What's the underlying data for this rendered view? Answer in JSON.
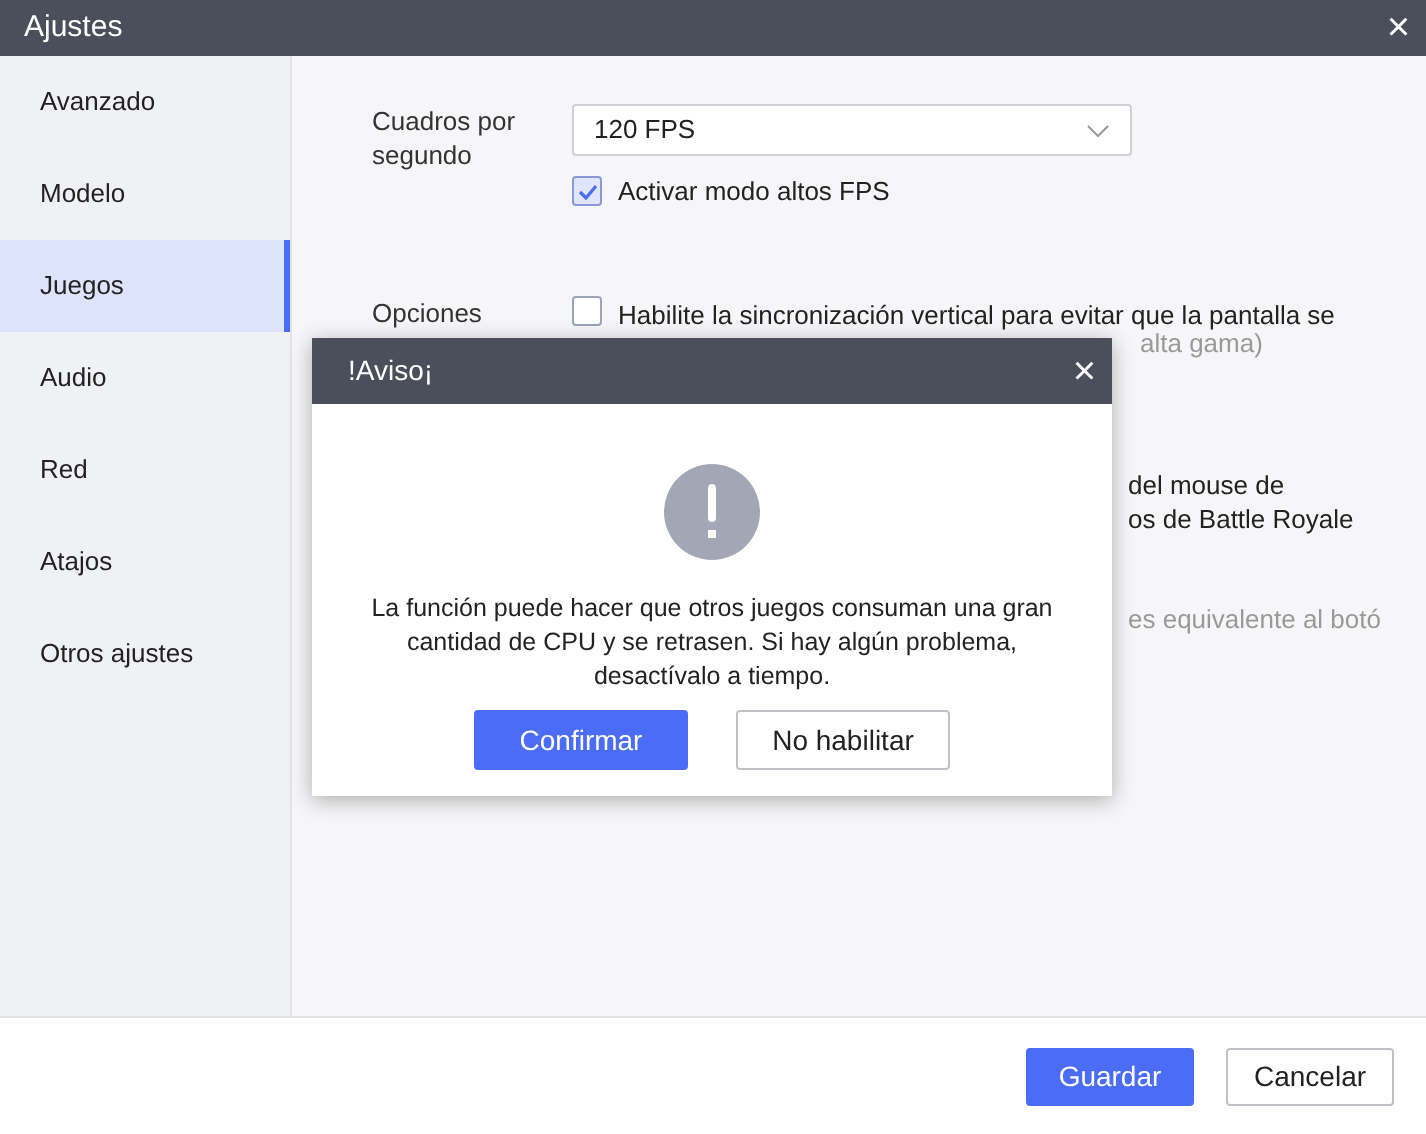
{
  "window": {
    "title": "Ajustes",
    "close": "×"
  },
  "sidebar": {
    "items": [
      {
        "label": "Avanzado",
        "selected": false
      },
      {
        "label": "Modelo",
        "selected": false
      },
      {
        "label": "Juegos",
        "selected": true
      },
      {
        "label": "Audio",
        "selected": false
      },
      {
        "label": "Red",
        "selected": false
      },
      {
        "label": "Atajos",
        "selected": false
      },
      {
        "label": "Otros ajustes",
        "selected": false
      }
    ]
  },
  "fps": {
    "label": "Cuadros por segundo",
    "value": "120 FPS",
    "high_fps": {
      "label": "Activar modo altos FPS",
      "checked": true
    }
  },
  "options": {
    "label": "Opciones",
    "vsync": {
      "label": "Habilite la sincronización vertical para evitar que la pantalla se",
      "checked": false
    }
  },
  "partly_hidden": [
    {
      "text": "alta gama)",
      "muted": true
    },
    {
      "text": "del mouse de",
      "muted": false
    },
    {
      "text": "os de Battle Royale",
      "muted": false
    },
    {
      "text": "es equivalente al botó",
      "muted": true
    }
  ],
  "dialog": {
    "title": "!Aviso¡",
    "close": "×",
    "message": "La función puede hacer que otros juegos consuman una gran cantidad de CPU y se retrasen. Si hay algún problema, desactívalo a tiempo.",
    "buttons": [
      {
        "label": "Confirmar",
        "kind": "primary"
      },
      {
        "label": "No habilitar",
        "kind": "secondary"
      }
    ]
  },
  "footer": {
    "buttons": [
      {
        "label": "Guardar",
        "kind": "primary"
      },
      {
        "label": "Cancelar",
        "kind": "secondary"
      }
    ]
  }
}
